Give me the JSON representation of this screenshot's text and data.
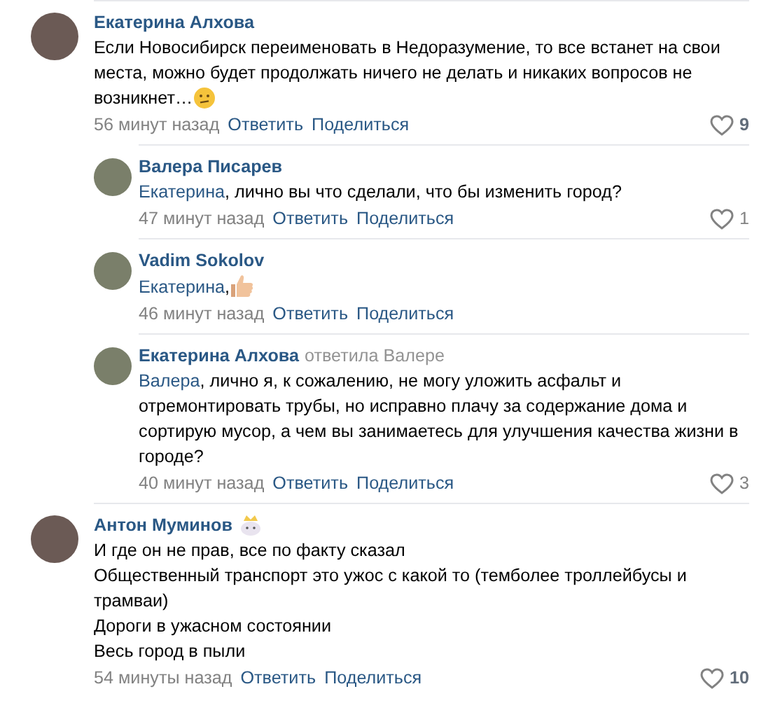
{
  "comments": [
    {
      "author": "Екатерина Алхова",
      "parts": [
        {
          "kind": "text",
          "text": "Если Новосибирск переименовать в Недоразумение, то все встанет на свои места, можно будет продолжать ничего не делать и никаких вопросов не возникнет…"
        },
        {
          "kind": "smiley"
        }
      ],
      "time": "56 минут назад",
      "actions": [
        "Ответить",
        "Поделиться"
      ],
      "likes": "9",
      "replies": [
        {
          "author": "Валера Писарев",
          "parts": [
            {
              "kind": "mention",
              "text": "Екатерина"
            },
            {
              "kind": "text",
              "text": ", лично вы что сделали, что бы изменить город?"
            }
          ],
          "time": "47 минут назад",
          "actions": [
            "Ответить",
            "Поделиться"
          ],
          "likes": "1"
        },
        {
          "author": "Vadim Sokolov",
          "parts": [
            {
              "kind": "mention",
              "text": "Екатерина"
            },
            {
              "kind": "text",
              "text": ","
            },
            {
              "kind": "thumbsup"
            }
          ],
          "time": "46 минут назад",
          "actions": [
            "Ответить",
            "Поделиться"
          ]
        },
        {
          "author": "Екатерина Алхова",
          "reply_to": "ответила Валере",
          "parts": [
            {
              "kind": "mention",
              "text": "Валера"
            },
            {
              "kind": "text",
              "text": ", лично я, к сожалению, не могу уложить асфальт и отремонтировать трубы, но исправно плачу за содержание дома и сортирую мусор, а чем вы занимаетесь для улучшения качества жизни в городе?"
            }
          ],
          "time": "40 минут назад",
          "actions": [
            "Ответить",
            "Поделиться"
          ],
          "likes": "3"
        }
      ]
    },
    {
      "author": "Антон Муминов",
      "author_badge": true,
      "lines": [
        "И где он не прав, все по факту сказал",
        "Общественный транспорт это ужос с какой то (темболее троллейбусы и трамваи)",
        "Дороги в ужасном состоянии",
        "Весь город в пыли"
      ],
      "time": "54 минуты назад",
      "actions": [
        "Ответить",
        "Поделиться"
      ],
      "likes": "10"
    }
  ]
}
